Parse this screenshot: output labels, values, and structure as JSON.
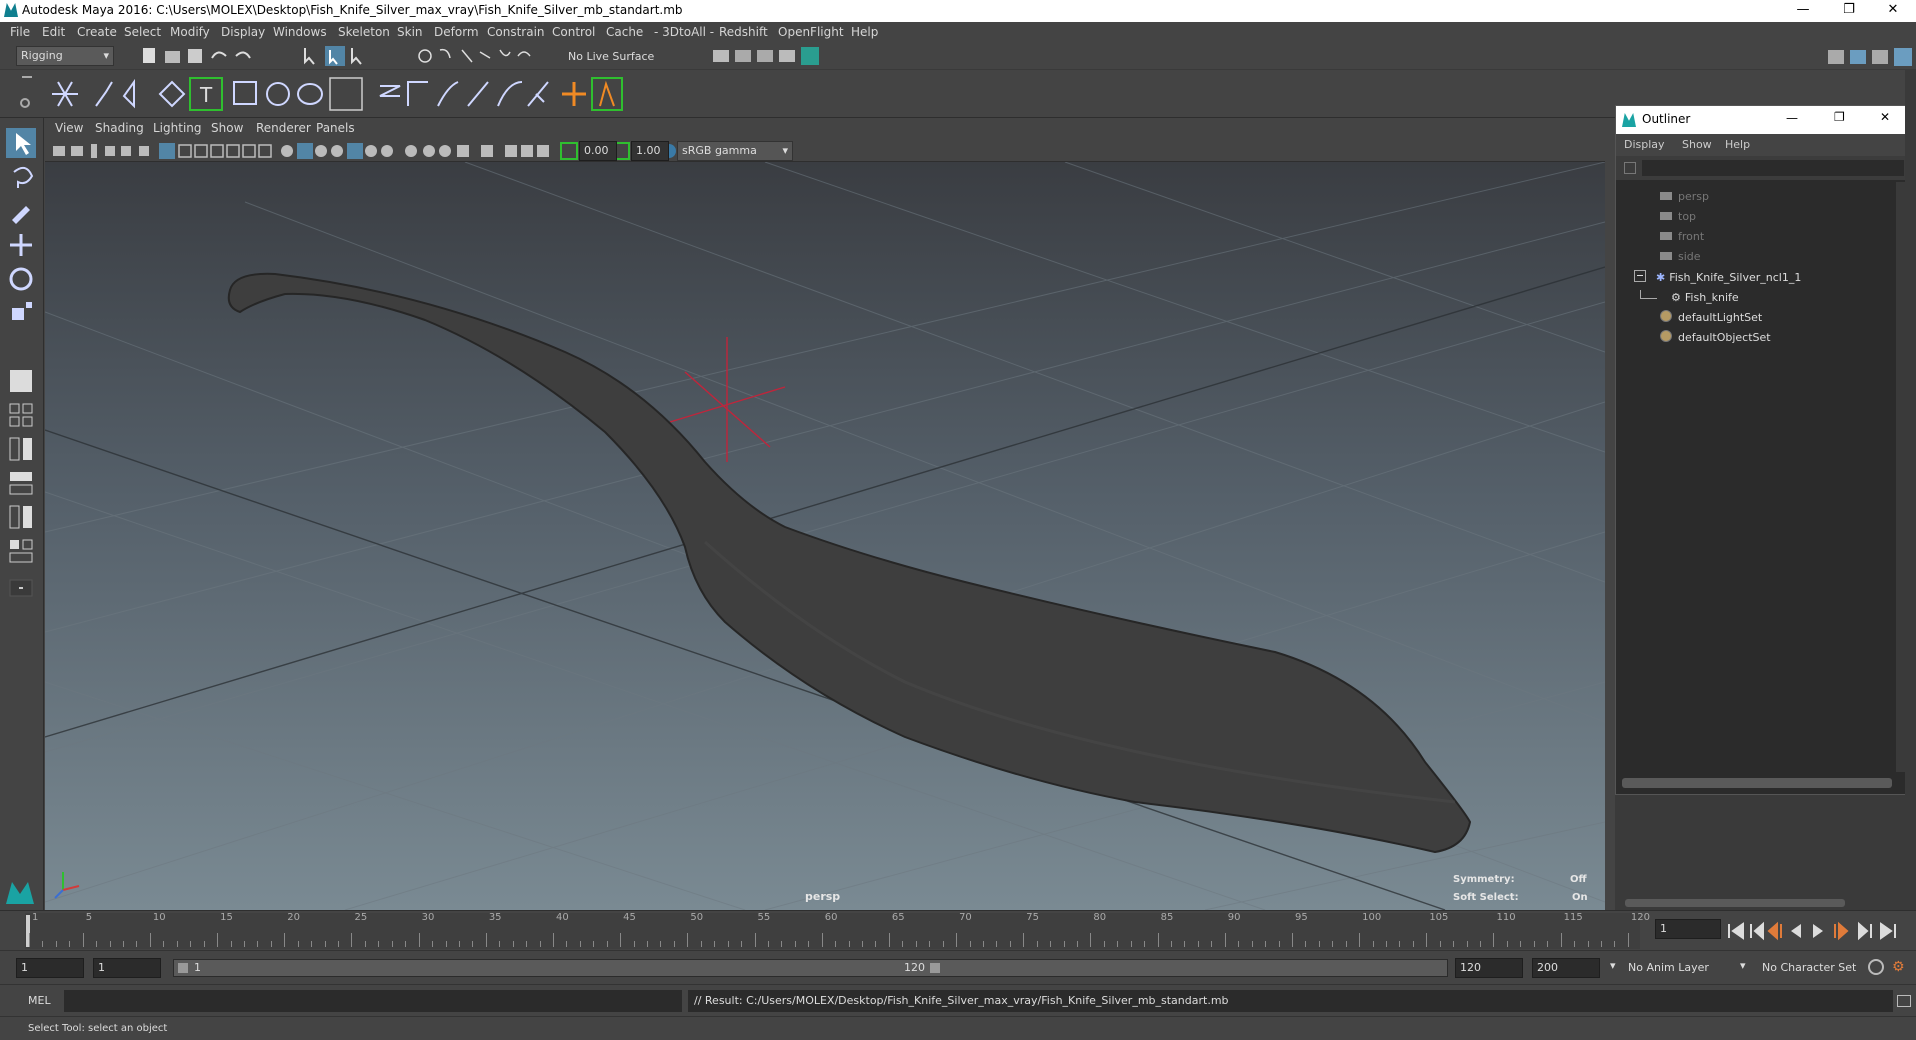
{
  "window": {
    "title": "Autodesk Maya 2016: C:\\Users\\MOLEX\\Desktop\\Fish_Knife_Silver_max_vray\\Fish_Knife_Silver_mb_standart.mb",
    "min": "—",
    "max": "❐",
    "close": "✕"
  },
  "menubar": [
    "File",
    "Edit",
    "Create",
    "Select",
    "Modify",
    "Display",
    "Windows",
    "Skeleton",
    "Skin",
    "Deform",
    "Constrain",
    "Control",
    "Cache",
    "- 3DtoAll -",
    "Redshift",
    "OpenFlight",
    "Help"
  ],
  "statusline": {
    "mode": "Rigging",
    "live_surface": "No Live Surface"
  },
  "viewport": {
    "menu": [
      "View",
      "Shading",
      "Lighting",
      "Show",
      "Renderer",
      "Panels"
    ],
    "exposure": "0.00",
    "gamma": "1.00",
    "colorspace": "sRGB gamma",
    "camera_label": "persp",
    "symmetry_label": "Symmetry:",
    "symmetry_value": "Off",
    "softselect_label": "Soft Select:",
    "softselect_value": "On"
  },
  "outliner": {
    "title": "Outliner",
    "menu": [
      "Display",
      "Show",
      "Help"
    ],
    "items": [
      {
        "label": "persp",
        "type": "camera",
        "dim": true
      },
      {
        "label": "top",
        "type": "camera",
        "dim": true
      },
      {
        "label": "front",
        "type": "camera",
        "dim": true
      },
      {
        "label": "side",
        "type": "camera",
        "dim": true
      },
      {
        "label": "Fish_Knife_Silver_ncl1_1",
        "type": "group",
        "dim": false
      },
      {
        "label": "Fish_knife",
        "type": "mesh",
        "dim": false
      },
      {
        "label": "defaultLightSet",
        "type": "set",
        "dim": false
      },
      {
        "label": "defaultObjectSet",
        "type": "set",
        "dim": false
      }
    ]
  },
  "timeline": {
    "ticks": [
      "1",
      "5",
      "10",
      "15",
      "20",
      "25",
      "30",
      "35",
      "40",
      "45",
      "50",
      "55",
      "60",
      "65",
      "70",
      "75",
      "80",
      "85",
      "90",
      "95",
      "100",
      "105",
      "110",
      "115",
      "120"
    ],
    "current_frame": "1"
  },
  "range": {
    "start": "1",
    "playback_start": "1",
    "slider_start": "1",
    "slider_end": "120",
    "playback_end": "120",
    "end": "200",
    "anim_layer": "No Anim Layer",
    "character_set": "No Character Set"
  },
  "command": {
    "language": "MEL",
    "result": "// Result: C:/Users/MOLEX/Desktop/Fish_Knife_Silver_max_vray/Fish_Knife_Silver_mb_standart.mb"
  },
  "helpline": "Select Tool: select an object",
  "colors": {
    "accent": "#0f7f8f",
    "highlight": "#5285a6",
    "green": "#2fbf2f"
  }
}
